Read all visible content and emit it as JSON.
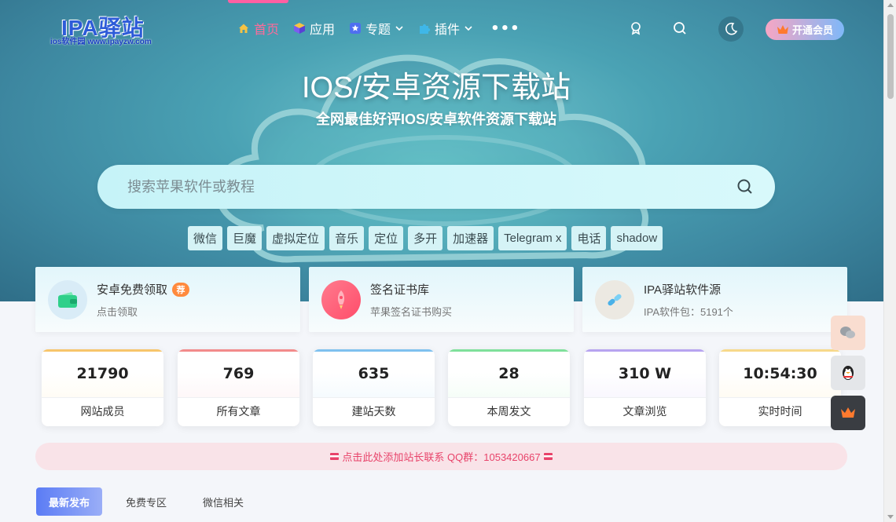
{
  "logo": {
    "main": "IPA驿站",
    "sub": "ios软件园 www.ipayzw.com"
  },
  "nav": {
    "items": [
      {
        "label": "首页",
        "icon": "home-icon",
        "active": true
      },
      {
        "label": "应用",
        "icon": "cube-icon",
        "active": false
      },
      {
        "label": "专题",
        "icon": "star-badge-icon",
        "dropdown": true
      },
      {
        "label": "插件",
        "icon": "puzzle-icon",
        "dropdown": true
      }
    ],
    "more": "•••",
    "vip_label": "开通会员"
  },
  "hero": {
    "title": "IOS/安卓资源下载站",
    "subtitle": "全网最佳好评IOS/安卓软件资源下载站"
  },
  "search": {
    "placeholder": "搜索苹果软件或教程"
  },
  "tags": [
    "微信",
    "巨魔",
    "虚拟定位",
    "音乐",
    "定位",
    "多开",
    "加速器",
    "Telegram x",
    "电话",
    "shadow"
  ],
  "features": [
    {
      "title": "安卓免费领取",
      "badge": "荐",
      "sub": "点击领取",
      "icon": "wallet-icon"
    },
    {
      "title": "签名证书库",
      "sub": "苹果签名证书购买",
      "icon": "rocket-icon"
    },
    {
      "title": "IPA驿站软件源",
      "sub": "IPA软件包：5191个",
      "icon": "link-icon"
    }
  ],
  "stats": [
    {
      "value": "21790",
      "label": "网站成员",
      "color": "#f7c56b"
    },
    {
      "value": "769",
      "label": "所有文章",
      "color": "#f28b8b"
    },
    {
      "value": "635",
      "label": "建站天数",
      "color": "#7fc1ef"
    },
    {
      "value": "28",
      "label": "本周发文",
      "color": "#7fe09b"
    },
    {
      "value": "310 W",
      "label": "文章浏览",
      "color": "#b7a4f0"
    },
    {
      "value": "10:54:30",
      "label": "实时时间",
      "color": "#f7d98a"
    }
  ],
  "notice": {
    "text": "点击此处添加站长联系 QQ群：1053420667"
  },
  "tabs": [
    {
      "label": "最新发布",
      "active": true
    },
    {
      "label": "免费专区",
      "active": false
    },
    {
      "label": "微信相关",
      "active": false
    }
  ]
}
